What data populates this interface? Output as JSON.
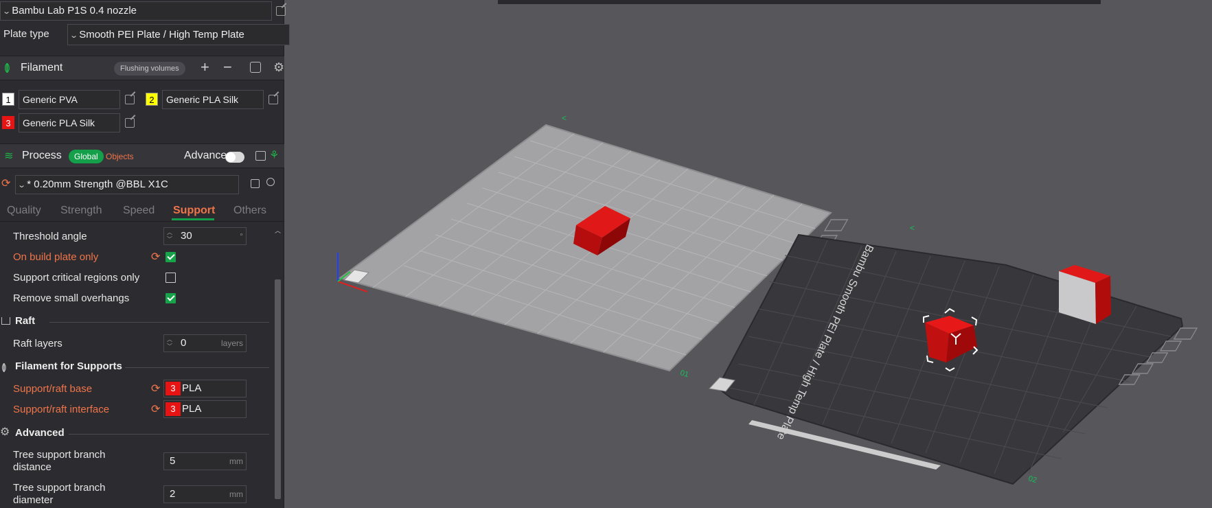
{
  "printer": {
    "name": "Bambu Lab P1S 0.4 nozzle"
  },
  "plate": {
    "label": "Plate type",
    "value": "Smooth PEI Plate / High Temp Plate"
  },
  "filament": {
    "title": "Filament",
    "flush_label": "Flushing volumes",
    "items": [
      {
        "index": "1",
        "name": "Generic PVA",
        "color": "#ffffff",
        "text_color": "#000000"
      },
      {
        "index": "2",
        "name": "Generic PLA Silk",
        "color": "#ffff00",
        "text_color": "#000000"
      },
      {
        "index": "3",
        "name": "Generic PLA Silk",
        "color": "#e81414",
        "text_color": "#ffffff"
      }
    ]
  },
  "process": {
    "title": "Process",
    "global_label": "Global",
    "objects_label": "Objects",
    "advance_label": "Advance",
    "preset": "* 0.20mm Strength @BBL X1C",
    "tabs": [
      "Quality",
      "Strength",
      "Speed",
      "Support",
      "Others"
    ],
    "active_tab": "Support"
  },
  "options": {
    "threshold_angle": {
      "label": "Threshold angle",
      "value": "30",
      "unit": "°"
    },
    "on_build_plate_only": {
      "label": "On build plate only",
      "checked": true
    },
    "support_critical": {
      "label": "Support critical regions only",
      "checked": false
    },
    "remove_small": {
      "label": "Remove small overhangs",
      "checked": true
    },
    "raft_group": "Raft",
    "raft_layers": {
      "label": "Raft layers",
      "value": "0",
      "unit": "layers"
    },
    "filament_group": "Filament for Supports",
    "support_base": {
      "label": "Support/raft base",
      "index": "3",
      "value": "PLA"
    },
    "support_interface": {
      "label": "Support/raft interface",
      "index": "3",
      "value": "PLA"
    },
    "advanced_group": "Advanced",
    "branch_distance": {
      "label_1": "Tree support branch",
      "label_2": "distance",
      "value": "5",
      "unit": "mm"
    },
    "branch_diameter": {
      "label_1": "Tree support branch",
      "label_2": "diameter",
      "value": "2",
      "unit": "mm"
    }
  },
  "scene": {
    "plate1_number": "01",
    "plate2_number": "02",
    "plate2_text": "Bambu Smooth PEI Plate / High Temp Plate",
    "cube_color": "#d01010",
    "plate1_color": "#a3a3a6",
    "plate2_color": "#38383c"
  },
  "icons": [
    "edit-icon",
    "filament-icon",
    "plus-icon",
    "minus-icon",
    "settings-icon",
    "process-icon",
    "reset-icon",
    "save-icon",
    "search-icon",
    "raft-icon",
    "advanced-icon"
  ]
}
